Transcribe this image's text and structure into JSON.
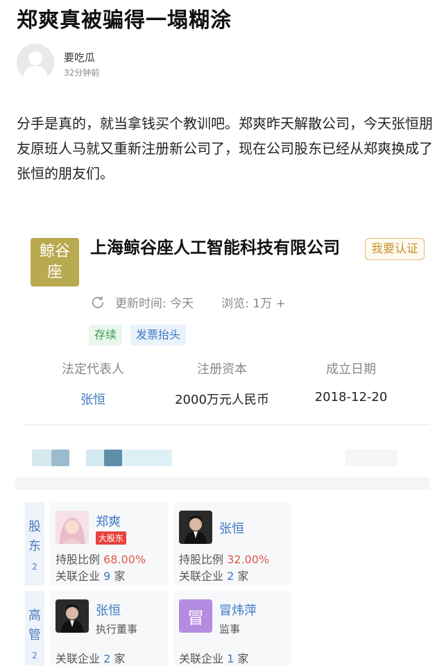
{
  "article": {
    "title": "郑爽真被骗得一塌糊涂",
    "author": "要吃瓜",
    "time": "32分钟前",
    "body": "分手是真的，就当拿钱买个教训吧。郑爽昨天解散公司，今天张恒朋友原班人马就又重新注册新公司了，现在公司股东已经从郑爽换成了张恒的朋友们。"
  },
  "company": {
    "logo_text": "鲸谷座",
    "name": "上海鲸谷座人工智能科技有限公司",
    "verify_label": "我要认证",
    "updated": "更新时间: 今天",
    "views": "浏览: 1万 +",
    "tags": [
      "存续",
      "发票抬头"
    ],
    "info": [
      {
        "label": "法定代表人",
        "value": "张恒"
      },
      {
        "label": "注册资本",
        "value": "2000万元人民币"
      },
      {
        "label": "成立日期",
        "value": "2018-12-20"
      }
    ]
  },
  "shareholders": {
    "label": "股东",
    "count": "2",
    "people": [
      {
        "name": "郑爽",
        "badge": "大股东",
        "ratio_label": "持股比例",
        "ratio": "68.00%",
        "related_label": "关联企业",
        "related_count": "9",
        "related_unit": "家"
      },
      {
        "name": "张恒",
        "ratio_label": "持股比例",
        "ratio": "32.00%",
        "related_label": "关联企业",
        "related_count": "2",
        "related_unit": "家"
      }
    ]
  },
  "executives": {
    "label": "高管",
    "count": "2",
    "people": [
      {
        "name": "张恒",
        "role": "执行董事",
        "related_label": "关联企业",
        "related_count": "2",
        "related_unit": "家"
      },
      {
        "name": "冒炜萍",
        "avatar_text": "冒",
        "role": "监事",
        "related_label": "关联企业",
        "related_count": "1",
        "related_unit": "家"
      }
    ]
  },
  "icons": {
    "refresh": "refresh-icon",
    "avatar": "user-avatar-icon"
  },
  "colors": {
    "logo": "#b9a94f",
    "link_blue": "#3a78c3",
    "badge_red": "#e8423c",
    "verify_orange": "#c8932e"
  }
}
